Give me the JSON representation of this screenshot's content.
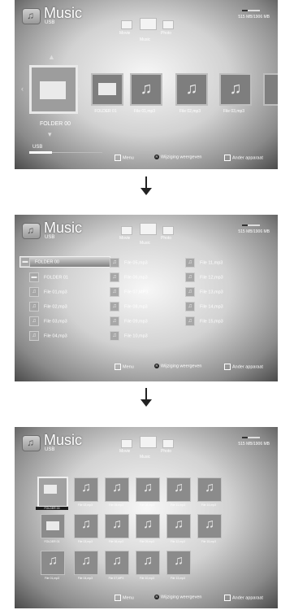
{
  "panel1": {
    "title": "Music",
    "subtitle": "USB",
    "storage": "515 MB/1906 MB",
    "categories": [
      "Movie",
      "Music",
      "Photo"
    ],
    "tiles": [
      "FOLDER 00",
      "FOLDER 01",
      "File 01,mp3",
      "File 02,mp3",
      "File 03,mp3"
    ],
    "selected_label": "FOLDER 00",
    "sort_label": "USB",
    "bottom": {
      "menu": "Menu",
      "view": "Wijziging weergeven",
      "device": "Ander apparaat"
    }
  },
  "panel2": {
    "title": "Music",
    "subtitle": "USB",
    "storage": "515 MB/1906 MB",
    "categories": [
      "Movie",
      "Music",
      "Photo"
    ],
    "col1": [
      "FOLDER 00",
      "FOLDER 01",
      "File 01,mp3",
      "File 02,mp3",
      "File 03,mp3",
      "File 04,mp3"
    ],
    "col2": [
      "File 05,mp3",
      "File 06,mp3",
      "File 07,MP3",
      "File 08,mp3",
      "File 09,mp3",
      "File 10,mp3"
    ],
    "col3": [
      "File 11,mp3",
      "File 12,mp3",
      "File 13,mp3",
      "File 14,mp3",
      "File 15,mp3"
    ],
    "bottom": {
      "menu": "Menu",
      "view": "Wijziging weergeven",
      "device": "Ander apparaat"
    }
  },
  "panel3": {
    "title": "Music",
    "subtitle": "USB",
    "storage": "515 MB/1906 MB",
    "categories": [
      "Movie",
      "Music",
      "Photo"
    ],
    "row1": [
      "FOLDER 00",
      "File 02,mp3",
      "File 05,mp3",
      "File 08,mp3",
      "File 11,mp3",
      "File 14,mp3"
    ],
    "row2": [
      "FOLDER 01",
      "File 03,mp3",
      "File 06,mp3",
      "File 09,mp3",
      "File 12,mp3",
      "File 15,mp3"
    ],
    "row3": [
      "File 01,mp3",
      "File 04,mp3",
      "File 07,MP3",
      "File 10,mp3",
      "File 13,mp3"
    ],
    "bottom": {
      "menu": "Menu",
      "view": "Wijziging weergeven",
      "device": "Ander apparaat"
    }
  }
}
